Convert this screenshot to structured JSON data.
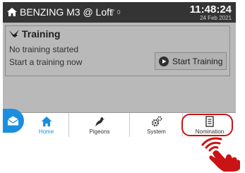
{
  "statusbar": {
    "title": "BENZING M3 @ Loft",
    "signal_count": "0",
    "time": "11:48:24",
    "date": "24 Feb 2021",
    "home_icon": "home-icon",
    "signal_icon": "signal-icon"
  },
  "training": {
    "title": "Training",
    "line1": "No training started",
    "line2": "Start a training now",
    "start_button": "Start Training",
    "title_icon": "pigeon-flying-icon",
    "button_icon": "play-circle-icon"
  },
  "nav": {
    "items": [
      {
        "label": "Home",
        "icon": "home-icon"
      },
      {
        "label": "Pigeons",
        "icon": "pigeon-icon"
      },
      {
        "label": "System",
        "icon": "gears-icon"
      },
      {
        "label": "Nomination",
        "icon": "clipboard-icon"
      }
    ],
    "mail_icon": "mail-icon"
  },
  "colors": {
    "accent": "#1a8fe0",
    "statusbar_bg": "#343434",
    "screen_bg": "#b9b9b9",
    "highlight": "#c81414"
  }
}
